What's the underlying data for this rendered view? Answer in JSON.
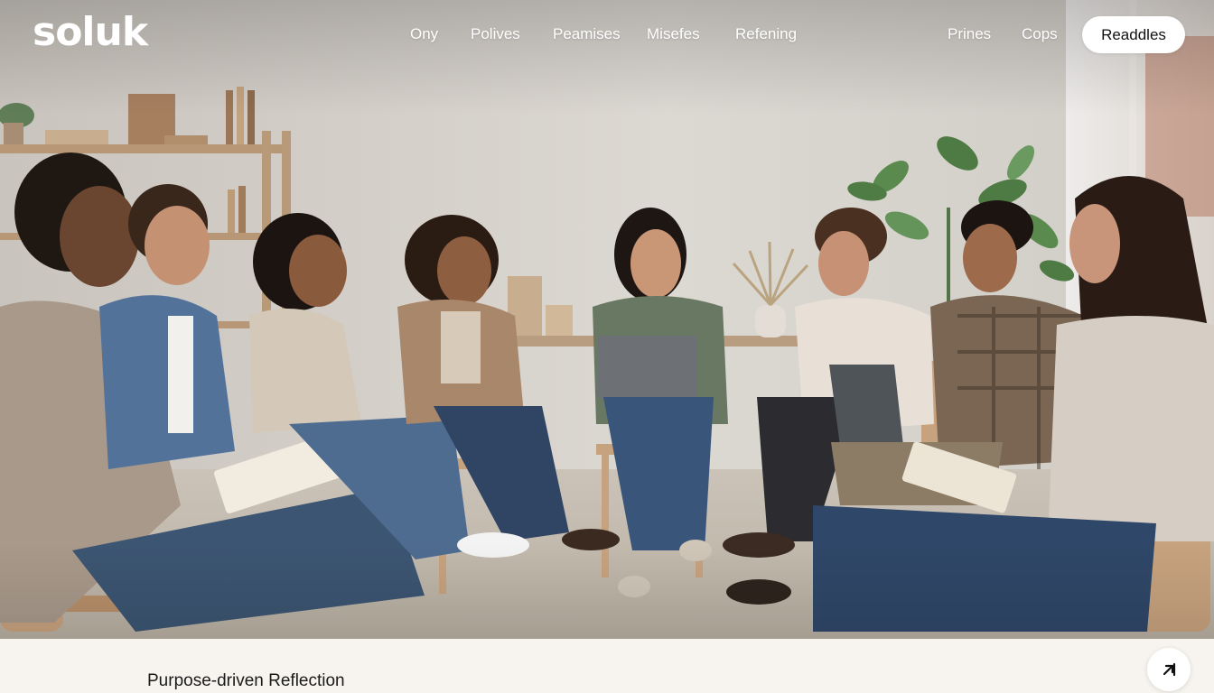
{
  "brand": {
    "logo_text": "soluk"
  },
  "nav": {
    "links": [
      "Ony",
      "Polives",
      "Peamises",
      "Misefes",
      "Refening"
    ],
    "secondary_links": [
      "Prines",
      "Cops"
    ],
    "cta_label": "Readdles"
  },
  "hero": {
    "image_description_icon": "group-session-photo",
    "caption": "Purpose-driven Reflection"
  },
  "corner_button": {
    "icon": "arrow-out-icon"
  },
  "colors": {
    "nav_text": "#ffffff",
    "cta_bg": "#ffffff",
    "bottom_bg": "#f7f4ef",
    "caption_text": "#1b1b1b"
  }
}
